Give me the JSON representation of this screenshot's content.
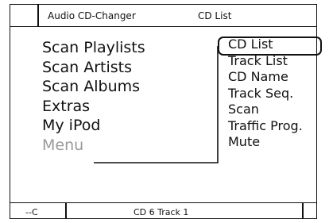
{
  "header": {
    "app_title": "Audio CD-Changer",
    "mode_title": "CD List"
  },
  "main_menu": {
    "items": [
      {
        "label": "Scan Playlists"
      },
      {
        "label": "Scan Artists"
      },
      {
        "label": "Scan Albums"
      },
      {
        "label": "Extras"
      },
      {
        "label": "My iPod"
      },
      {
        "label": "Menu",
        "state": "disabled"
      }
    ]
  },
  "submenu": {
    "selected_label": "CD List",
    "items": [
      {
        "label": "CD List"
      },
      {
        "label": "Track List"
      },
      {
        "label": "CD Name"
      },
      {
        "label": "Track Seq."
      },
      {
        "label": "Scan"
      },
      {
        "label": "Traffic Prog."
      },
      {
        "label": "Mute"
      }
    ]
  },
  "footer": {
    "left_text": "--C",
    "status_text": "CD 6 Track 1"
  }
}
